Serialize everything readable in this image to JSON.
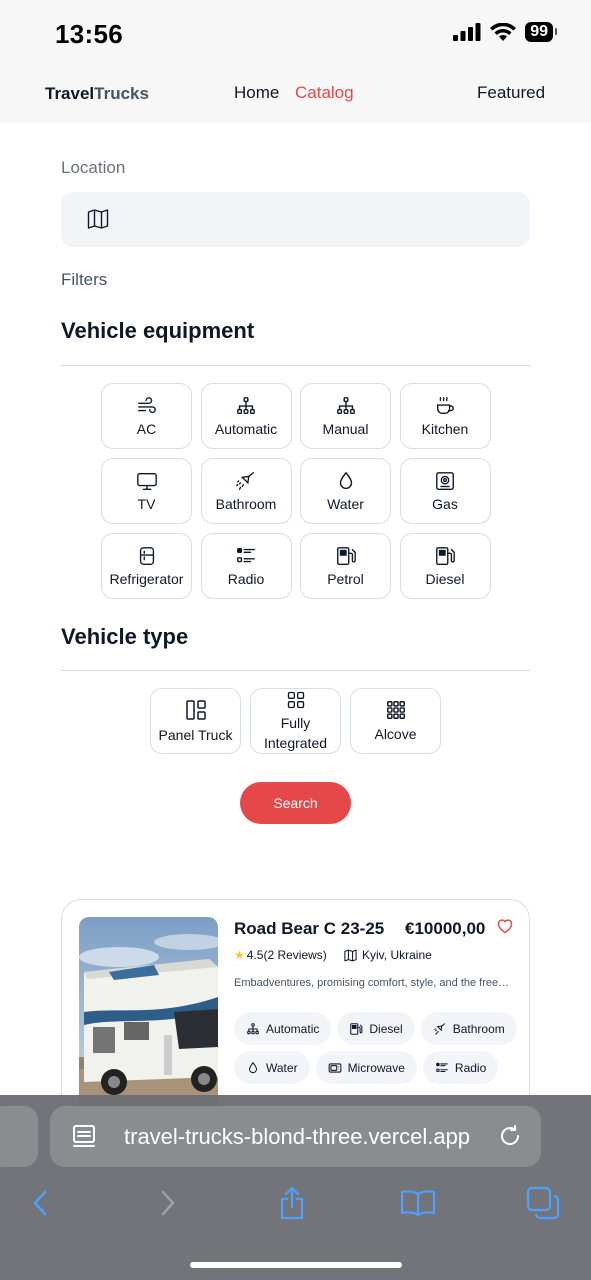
{
  "status_bar": {
    "time": "13:56",
    "battery": "99"
  },
  "header": {
    "logo_part1": "Travel",
    "logo_part2": "Trucks",
    "nav": {
      "home": "Home",
      "catalog": "Catalog",
      "featured": "Featured"
    }
  },
  "location": {
    "label": "Location",
    "value": "",
    "placeholder": ""
  },
  "filters": {
    "label": "Filters",
    "equipment_title": "Vehicle equipment",
    "equipment": [
      {
        "label": "AC",
        "icon": "wind-icon"
      },
      {
        "label": "Automatic",
        "icon": "diagram-icon"
      },
      {
        "label": "Manual",
        "icon": "diagram-icon"
      },
      {
        "label": "Kitchen",
        "icon": "cup-hot-icon"
      },
      {
        "label": "TV",
        "icon": "tv-icon"
      },
      {
        "label": "Bathroom",
        "icon": "shower-icon"
      },
      {
        "label": "Water",
        "icon": "droplet-icon"
      },
      {
        "label": "Gas",
        "icon": "stove-icon"
      },
      {
        "label": "Refrigerator",
        "icon": "fridge-icon"
      },
      {
        "label": "Radio",
        "icon": "list-icon"
      },
      {
        "label": "Petrol",
        "icon": "fuel-pump-icon"
      },
      {
        "label": "Diesel",
        "icon": "fuel-pump-icon"
      }
    ],
    "type_title": "Vehicle type",
    "types": [
      {
        "label": "Panel Truck",
        "icon": "grid-1x2-icon"
      },
      {
        "label": "Fully Integrated",
        "line1": "Fully",
        "line2": "Integrated",
        "icon": "grid-icon"
      },
      {
        "label": "Alcove",
        "icon": "grid-3x3-icon"
      }
    ],
    "search_label": "Search"
  },
  "card": {
    "title": "Road Bear C 23-25",
    "price": "€10000,00",
    "rating": "4.5(2 Reviews)",
    "location": "Kyiv, Ukraine",
    "description": "Embadventures, promising comfort, style, and the freedom to explore at your own pace.",
    "features": [
      "Automatic",
      "Diesel",
      "Bathroom",
      "Water",
      "Microwave",
      "Radio"
    ]
  },
  "browser": {
    "url": "travel-trucks-blond-three.vercel.app"
  },
  "colors": {
    "accent": "#E44848",
    "text": "#101828",
    "muted": "#6C717B",
    "field_bg": "#F2F4F7",
    "border": "#DADDE1"
  }
}
